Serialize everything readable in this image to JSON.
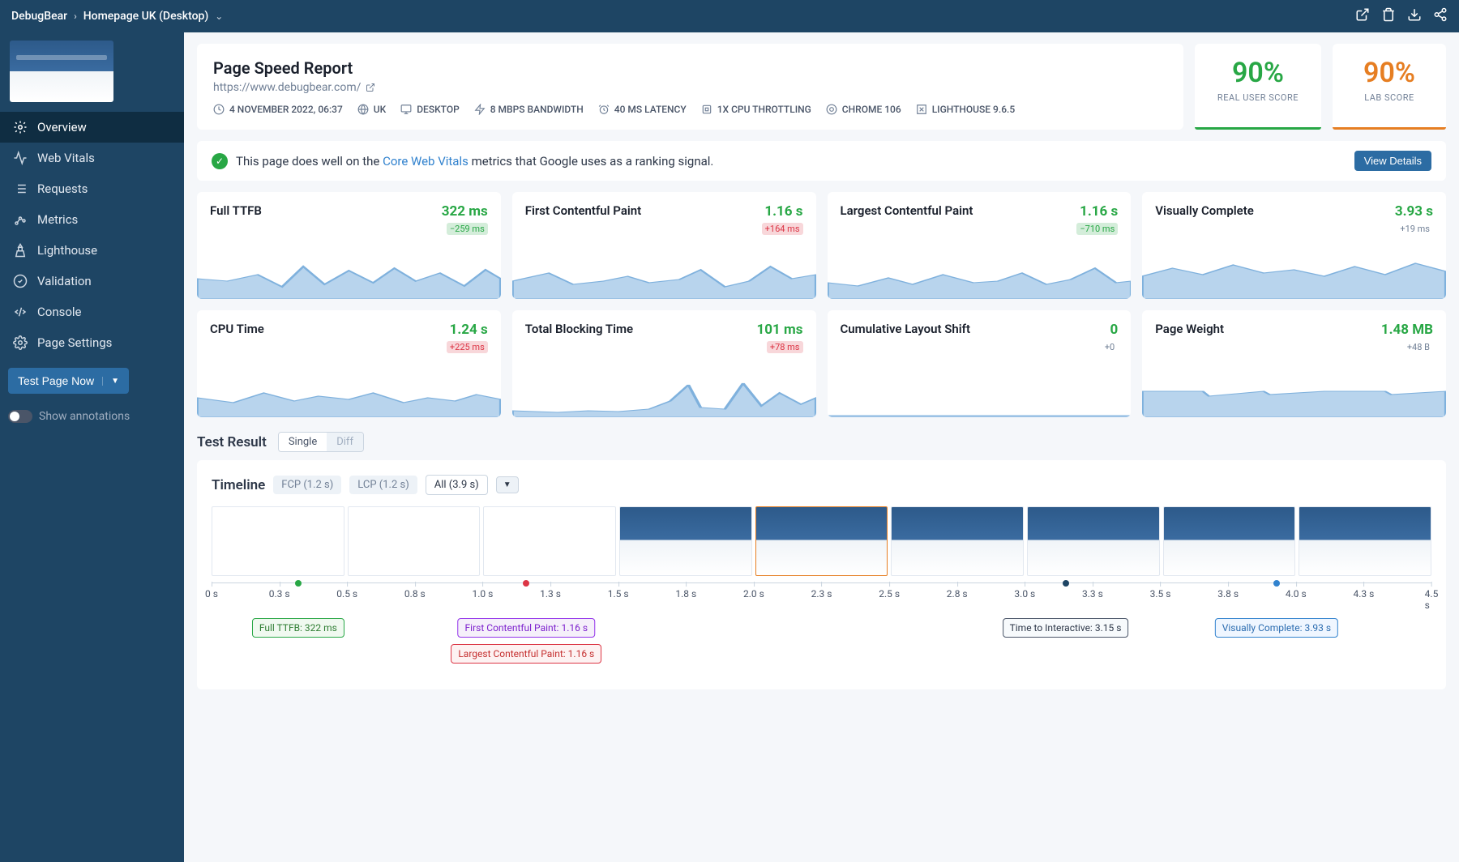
{
  "breadcrumb": {
    "root": "DebugBear",
    "page": "Homepage UK (Desktop)"
  },
  "sidebar": {
    "items": [
      {
        "label": "Overview",
        "active": true
      },
      {
        "label": "Web Vitals"
      },
      {
        "label": "Requests"
      },
      {
        "label": "Metrics"
      },
      {
        "label": "Lighthouse"
      },
      {
        "label": "Validation"
      },
      {
        "label": "Console"
      },
      {
        "label": "Page Settings"
      }
    ],
    "testNow": "Test Page Now",
    "showAnnotations": "Show annotations"
  },
  "report": {
    "title": "Page Speed Report",
    "url": "https://www.debugbear.com/",
    "meta": {
      "date": "4 NOVEMBER 2022, 06:37",
      "region": "UK",
      "device": "DESKTOP",
      "bandwidth": "8 MBPS BANDWIDTH",
      "latency": "40 MS LATENCY",
      "cpu": "1X CPU THROTTLING",
      "chrome": "CHROME 106",
      "lighthouse": "LIGHTHOUSE 9.6.5"
    }
  },
  "scores": {
    "real": {
      "value": "90%",
      "label": "REAL USER SCORE"
    },
    "lab": {
      "value": "90%",
      "label": "LAB SCORE"
    }
  },
  "vitals": {
    "prefix": "This page does well on the ",
    "link": "Core Web Vitals",
    "suffix": " metrics that Google uses as a ranking signal.",
    "button": "View Details"
  },
  "metrics": [
    {
      "name": "Full TTFB",
      "value": "322 ms",
      "delta": "−259 ms",
      "deltaClass": "pos-green"
    },
    {
      "name": "First Contentful Paint",
      "value": "1.16 s",
      "delta": "+164 ms",
      "deltaClass": "pos-red"
    },
    {
      "name": "Largest Contentful Paint",
      "value": "1.16 s",
      "delta": "−710 ms",
      "deltaClass": "pos-green"
    },
    {
      "name": "Visually Complete",
      "value": "3.93 s",
      "delta": "+19 ms",
      "deltaClass": "neutral"
    },
    {
      "name": "CPU Time",
      "value": "1.24 s",
      "delta": "+225 ms",
      "deltaClass": "pos-red"
    },
    {
      "name": "Total Blocking Time",
      "value": "101 ms",
      "delta": "+78 ms",
      "deltaClass": "pos-red"
    },
    {
      "name": "Cumulative Layout Shift",
      "value": "0",
      "delta": "+0",
      "deltaClass": "neutral"
    },
    {
      "name": "Page Weight",
      "value": "1.48 MB",
      "delta": "+48 B",
      "deltaClass": "neutral"
    }
  ],
  "testResult": {
    "title": "Test Result",
    "single": "Single",
    "diff": "Diff"
  },
  "timeline": {
    "title": "Timeline",
    "tabs": {
      "fcp": "FCP (1.2 s)",
      "lcp": "LCP (1.2 s)",
      "all": "All (3.9 s)"
    },
    "ticks": [
      "0 s",
      "0.3 s",
      "0.5 s",
      "0.8 s",
      "1.0 s",
      "1.3 s",
      "1.5 s",
      "1.8 s",
      "2.0 s",
      "2.3 s",
      "2.5 s",
      "2.8 s",
      "3.0 s",
      "3.3 s",
      "3.5 s",
      "3.8 s",
      "4.0 s",
      "4.3 s",
      "4.5 s"
    ],
    "events": {
      "ttfb": "Full TTFB: 322 ms",
      "fcp": "First Contentful Paint: 1.16 s",
      "lcp": "Largest Contentful Paint: 1.16 s",
      "tti": "Time to Interactive: 3.15 s",
      "vc": "Visually Complete: 3.93 s"
    }
  },
  "chart_data": {
    "type": "line",
    "note": "Sparkline mini-charts per metric card; values estimated",
    "series": [
      {
        "name": "Full TTFB (ms)",
        "values": [
          420,
          380,
          560,
          340,
          480,
          410,
          390,
          520,
          360,
          480,
          322
        ]
      },
      {
        "name": "First Contentful Paint (s)",
        "values": [
          1.0,
          1.3,
          0.95,
          1.1,
          1.05,
          1.4,
          1.0,
          1.15,
          1.6,
          1.2,
          1.16
        ]
      },
      {
        "name": "Largest Contentful Paint (s)",
        "values": [
          1.4,
          1.3,
          1.7,
          1.2,
          1.65,
          1.35,
          1.3,
          1.5,
          1.25,
          1.9,
          1.16
        ]
      },
      {
        "name": "Visually Complete (s)",
        "values": [
          3.8,
          4.4,
          4.0,
          4.5,
          4.1,
          3.9,
          4.2,
          4.3,
          4.0,
          4.6,
          3.93
        ]
      },
      {
        "name": "CPU Time (s)",
        "values": [
          1.1,
          0.95,
          1.3,
          1.0,
          1.25,
          1.05,
          1.08,
          1.2,
          0.98,
          1.15,
          1.24
        ]
      },
      {
        "name": "Total Blocking Time (ms)",
        "values": [
          30,
          20,
          25,
          22,
          28,
          24,
          35,
          120,
          26,
          140,
          101
        ]
      },
      {
        "name": "Cumulative Layout Shift",
        "values": [
          0,
          0,
          0,
          0,
          0,
          0,
          0,
          0,
          0,
          0,
          0
        ]
      },
      {
        "name": "Page Weight (MB)",
        "values": [
          1.48,
          1.48,
          1.48,
          1.48,
          1.45,
          1.48,
          1.48,
          1.48,
          1.46,
          1.48,
          1.48
        ]
      }
    ],
    "timeline_markers": [
      {
        "label": "Full TTFB",
        "t": 0.322
      },
      {
        "label": "First Contentful Paint",
        "t": 1.16
      },
      {
        "label": "Largest Contentful Paint",
        "t": 1.16
      },
      {
        "label": "Time to Interactive",
        "t": 3.15
      },
      {
        "label": "Visually Complete",
        "t": 3.93
      }
    ],
    "xlim": [
      0,
      4.5
    ]
  }
}
